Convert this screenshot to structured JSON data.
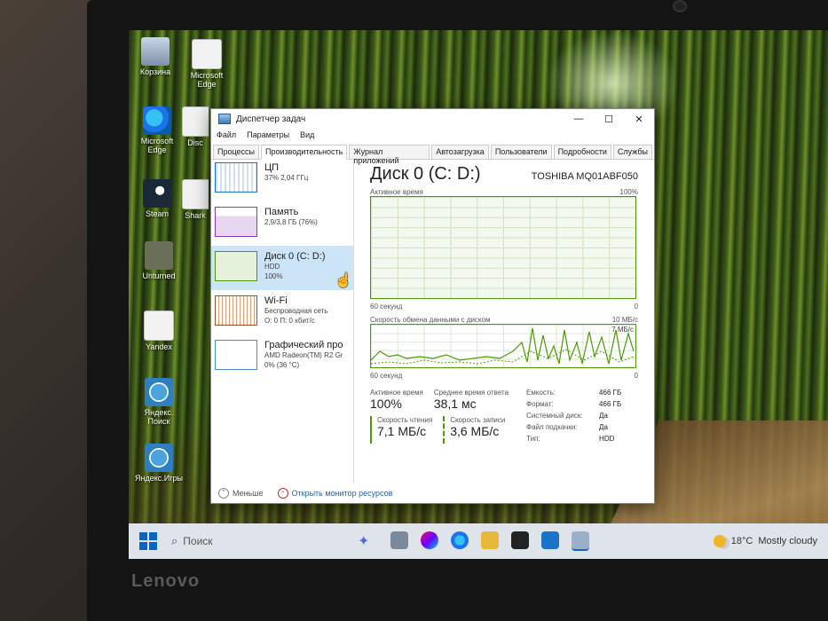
{
  "brand": "Lenovo",
  "desktop_icons": [
    {
      "label": "Корзина",
      "icon": "recycle-bin-icon"
    },
    {
      "label": "Microsoft Edge",
      "icon": "edge-icon"
    },
    {
      "label": "Microsoft Edge",
      "icon": "edge-icon"
    },
    {
      "label": "Disc",
      "icon": "file-icon"
    },
    {
      "label": "Steam",
      "icon": "steam-icon"
    },
    {
      "label": "Shark",
      "icon": "file-icon"
    },
    {
      "label": "Unturned",
      "icon": "game-icon"
    },
    {
      "label": "Yandex",
      "icon": "file-icon"
    },
    {
      "label": "Яндекс. Поиск",
      "icon": "ie-icon"
    },
    {
      "label": "Яндекс.Игры",
      "icon": "ie-icon"
    }
  ],
  "window": {
    "title": "Диспетчер задач",
    "controls": {
      "minimize": "—",
      "maximize": "☐",
      "close": "✕"
    },
    "menu": [
      "Файл",
      "Параметры",
      "Вид"
    ],
    "tabs": [
      "Процессы",
      "Производительность",
      "Журнал приложений",
      "Автозагрузка",
      "Пользователи",
      "Подробности",
      "Службы"
    ],
    "active_tab": "Производительность"
  },
  "resources": [
    {
      "name": "ЦП",
      "sub1": "37% 2,04 ГГц",
      "sub2": "",
      "type": "cpu"
    },
    {
      "name": "Память",
      "sub1": "2,9/3,8 ГБ (76%)",
      "sub2": "",
      "type": "mem"
    },
    {
      "name": "Диск 0 (C: D:)",
      "sub1": "HDD",
      "sub2": "100%",
      "type": "disk"
    },
    {
      "name": "Wi-Fi",
      "sub1": "Беспроводная сеть",
      "sub2": "О: 0 П: 0 кбит/с",
      "type": "wifi"
    },
    {
      "name": "Графический про",
      "sub1": "AMD Radeon(TM) R2 Gr",
      "sub2": "0% (36 °C)",
      "type": "gpu"
    }
  ],
  "disk": {
    "title": "Диск 0 (C: D:)",
    "model": "TOSHIBA MQ01ABF050",
    "chart1": {
      "label": "Активное время",
      "max": "100%",
      "time": "60 секунд",
      "min": "0"
    },
    "chart2": {
      "label": "Скорость обмена данными с диском",
      "max": "10 МБ/с",
      "scale": "7 МБ/с",
      "time": "60 секунд",
      "min": "0"
    },
    "active_time_label": "Активное время",
    "active_time_value": "100%",
    "avg_response_label": "Среднее время ответа",
    "avg_response_value": "38,1 мс",
    "read_speed_label": "Скорость чтения",
    "read_speed_value": "7,1 МБ/с",
    "write_speed_label": "Скорость записи",
    "write_speed_value": "3,6 МБ/с",
    "properties": [
      {
        "k": "Емкость:",
        "v": "466 ГБ"
      },
      {
        "k": "Формат:",
        "v": "466 ГБ"
      },
      {
        "k": "Системный диск:",
        "v": "Да"
      },
      {
        "k": "Файл подкачки:",
        "v": "Да"
      },
      {
        "k": "Тип:",
        "v": "HDD"
      }
    ]
  },
  "footer": {
    "less": "Меньше",
    "monitor": "Открыть монитор ресурсов"
  },
  "taskbar": {
    "search_placeholder": "Поиск",
    "weather_temp": "18°C",
    "weather_text": "Mostly cloudy"
  },
  "colors": {
    "disk_green": "#4e9a06",
    "selection": "#cce4f7",
    "accent": "#0a64c8"
  }
}
